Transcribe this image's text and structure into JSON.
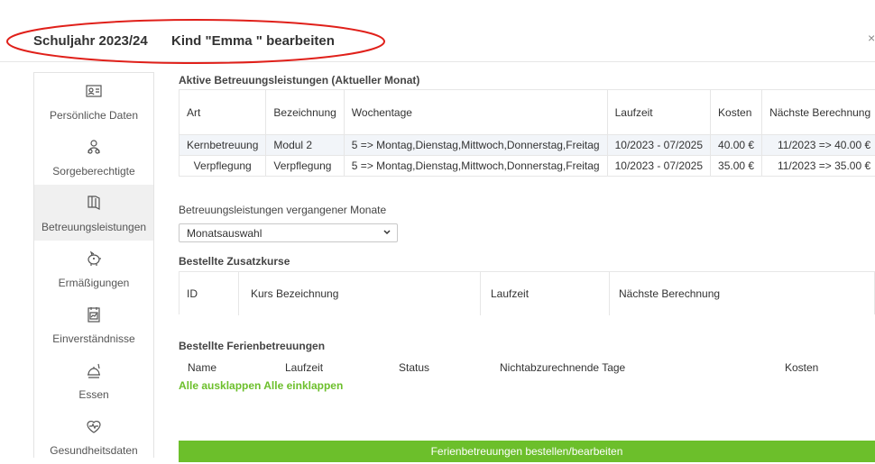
{
  "header": {
    "year": "Schuljahr 2023/24",
    "subtitle": "Kind \"Emma \" bearbeiten",
    "close": "×",
    "highlight_color": "#e0201a"
  },
  "sidebar": {
    "items": [
      {
        "label": "Persönliche Daten",
        "icon": "id-card-icon"
      },
      {
        "label": "Sorgeberechtigte",
        "icon": "people-icon"
      },
      {
        "label": "Betreuungsleistungen",
        "icon": "book-icon",
        "active": true
      },
      {
        "label": "Ermäßigungen",
        "icon": "piggy-bank-icon"
      },
      {
        "label": "Einverständnisse",
        "icon": "document-icon"
      },
      {
        "label": "Essen",
        "icon": "meal-icon"
      },
      {
        "label": "Gesundheitsdaten",
        "icon": "heart-pulse-icon"
      }
    ]
  },
  "active": {
    "title": "Aktive Betreuungsleistungen (Aktueller Monat)",
    "columns": [
      "Art",
      "Bezeichnung",
      "Wochentage",
      "Laufzeit",
      "Kosten",
      "Nächste Berechnung"
    ],
    "rows": [
      [
        "Kernbetreuung",
        "Modul 2",
        "5 => Montag,Dienstag,Mittwoch,Donnerstag,Freitag",
        "10/2023 - 07/2025",
        "40.00 €",
        "11/2023 => 40.00 €"
      ],
      [
        "Verpflegung",
        "Verpflegung",
        "5 => Montag,Dienstag,Mittwoch,Donnerstag,Freitag",
        "10/2023 - 07/2025",
        "35.00 €",
        "11/2023 => 35.00 €"
      ]
    ]
  },
  "past": {
    "label": "Betreuungsleistungen vergangener Monate",
    "select_value": "Monatsauswahl"
  },
  "kurse": {
    "title": "Bestellte Zusatzkurse",
    "columns": [
      "ID",
      "Kurs Bezeichnung",
      "Laufzeit",
      "Nächste Berechnung"
    ]
  },
  "ferien": {
    "title": "Bestellte Ferienbetreuungen",
    "columns": [
      "Name",
      "Laufzeit",
      "Status",
      "Nichtabzurechnende Tage",
      "Kosten"
    ],
    "expand_all": "Alle ausklappen",
    "collapse_all": "Alle einklappen",
    "button": "Ferienbetreuungen bestellen/bearbeiten",
    "accent_color": "#6cbf2b"
  }
}
